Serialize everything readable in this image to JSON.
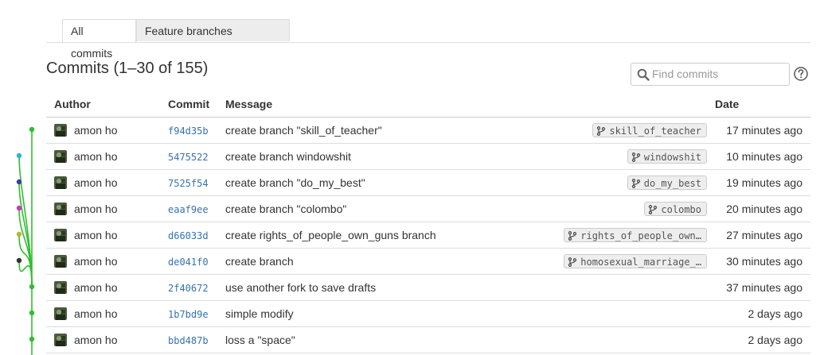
{
  "tabs": [
    {
      "label": "All commits",
      "active": true
    },
    {
      "label": "Feature branches",
      "active": false
    }
  ],
  "header": {
    "title": "Commits (1–30 of 155)"
  },
  "search": {
    "placeholder": "Find commits",
    "value": ""
  },
  "table": {
    "columns": [
      "Author",
      "Commit",
      "Message",
      "Date"
    ],
    "rows": [
      {
        "author": "amon ho",
        "sha": "f94d35b",
        "message": "create branch \"skill_of_teacher\"",
        "branch": "skill_of_teacher",
        "date": "17 minutes ago"
      },
      {
        "author": "amon ho",
        "sha": "5475522",
        "message": "create branch windowshit",
        "branch": "windowshit",
        "date": "10 minutes ago"
      },
      {
        "author": "amon ho",
        "sha": "7525f54",
        "message": "create branch \"do_my_best\"",
        "branch": "do_my_best",
        "date": "19 minutes ago"
      },
      {
        "author": "amon ho",
        "sha": "eaaf9ee",
        "message": "create branch \"colombo\"",
        "branch": "colombo",
        "date": "20 minutes ago"
      },
      {
        "author": "amon ho",
        "sha": "d66033d",
        "message": "create rights_of_people_own_guns branch",
        "branch": "rights_of_people_own…",
        "date": "27 minutes ago"
      },
      {
        "author": "amon ho",
        "sha": "de041f0",
        "message": "create branch",
        "branch": "homosexual_marriage_…",
        "date": "30 minutes ago"
      },
      {
        "author": "amon ho",
        "sha": "2f40672",
        "message": "use another fork to save drafts",
        "branch": "",
        "date": "37 minutes ago"
      },
      {
        "author": "amon ho",
        "sha": "1b7bd9e",
        "message": "simple modify",
        "branch": "",
        "date": "2 days ago"
      },
      {
        "author": "amon ho",
        "sha": "bbd487b",
        "message": "loss a \"space\"",
        "branch": "",
        "date": "2 days ago"
      }
    ]
  },
  "graph": {
    "main_color": "#2fbf2f",
    "branch_colors": [
      "#2fbf2f",
      "#2ab7c9",
      "#3a3ab8",
      "#c838c8",
      "#b7b734",
      "#333333"
    ]
  },
  "icons": {
    "search": "search-icon",
    "help": "help-icon",
    "branch": "branch-icon",
    "avatar": "avatar"
  },
  "colors": {
    "link": "#3572b0",
    "border": "#dddddd",
    "tab_inactive_bg": "#ededed"
  }
}
